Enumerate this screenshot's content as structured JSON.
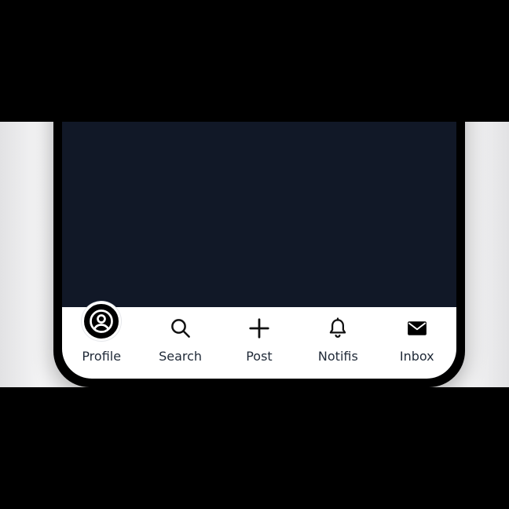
{
  "app": {
    "nav": {
      "active": "profile",
      "items": [
        {
          "id": "profile",
          "label": "Profile",
          "icon": "user-circle-icon"
        },
        {
          "id": "search",
          "label": "Search",
          "icon": "search-icon"
        },
        {
          "id": "post",
          "label": "Post",
          "icon": "plus-icon"
        },
        {
          "id": "notifications",
          "label": "Notifis",
          "icon": "bell-icon"
        },
        {
          "id": "inbox",
          "label": "Inbox",
          "icon": "mail-icon"
        }
      ]
    },
    "colors": {
      "content_background": "#111827",
      "tab_bar_background": "#ffffff",
      "active_indicator": "#000000",
      "label_text": "#1f2937"
    }
  }
}
